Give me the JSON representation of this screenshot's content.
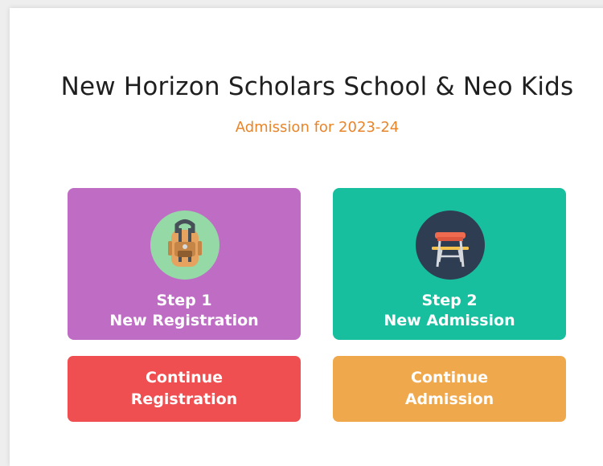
{
  "header": {
    "title": "New Horizon Scholars School & Neo Kids",
    "subtitle": "Admission for 2023-24"
  },
  "cards": {
    "registration": {
      "step": "Step 1",
      "label": "New Registration",
      "icon": "backpack-icon"
    },
    "admission": {
      "step": "Step 2",
      "label": "New Admission",
      "icon": "school-desk-chair-icon"
    }
  },
  "actions": {
    "continue_registration": {
      "line1": "Continue",
      "line2": "Registration"
    },
    "continue_admission": {
      "line1": "Continue",
      "line2": "Admission"
    }
  },
  "colors": {
    "subtitle": "#e8852a",
    "registration_card": "#be6cc4",
    "admission_card": "#17bf9f",
    "continue_registration": "#ef4f50",
    "continue_admission": "#efa94c"
  }
}
